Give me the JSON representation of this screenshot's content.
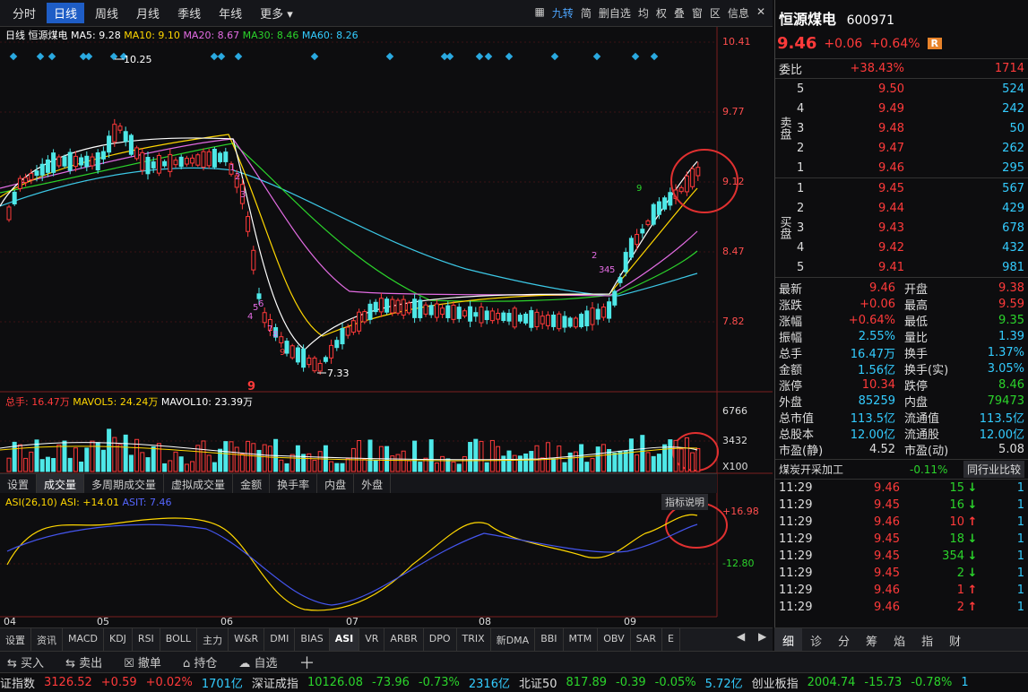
{
  "period_tabs": [
    "分时",
    "日线",
    "周线",
    "月线",
    "季线",
    "年线",
    "更多 ▾"
  ],
  "toolbar": {
    "items": [
      "▦",
      "九转",
      "简",
      "删自选",
      "均",
      "权",
      "叠",
      "窗",
      "区",
      "信息"
    ],
    "close": "✕"
  },
  "chart": {
    "legend": {
      "name": "日线",
      "stock": "恒源煤电",
      "ma5": "MA5: 9.28",
      "ma10": "MA10: 9.10",
      "ma20": "MA20: 8.67",
      "ma30": "MA30: 8.46",
      "ma60": "MA60: 8.26"
    },
    "price_ticks": [
      "10.41",
      "9.77",
      "9.12",
      "8.47",
      "7.82"
    ],
    "high_label": "10.25",
    "low_label": "7.33",
    "bottom_mark": "9",
    "td_left": [
      "1",
      "2",
      "3",
      "4",
      "5",
      "6",
      "7",
      "8",
      "9"
    ],
    "td_right": [
      "2",
      "3",
      "4",
      "5",
      "9"
    ],
    "vol_legend": {
      "total": "总手: 16.47万",
      "mavol5": "MAVOL5: 24.24万",
      "mavol10": "MAVOL10: 23.39万"
    },
    "vol_ticks": [
      "6766",
      "3432",
      "X100"
    ],
    "indicator_tabs": [
      "设置",
      "成交量",
      "多周期成交量",
      "虚拟成交量",
      "金额",
      "换手率",
      "内盘",
      "外盘"
    ],
    "asi_legend": {
      "a": "ASI(26,10) ASI: +14.01",
      "b": "ASIT: 7.46"
    },
    "asi_ticks": [
      "+16.98",
      "-12.80"
    ],
    "indicator_help": "指标说明",
    "months": [
      "04",
      "05",
      "06",
      "07",
      "08",
      "09"
    ]
  },
  "bottom_tabs": [
    "设置",
    "资讯",
    "MACD",
    "KDJ",
    "RSI",
    "BOLL",
    "主力",
    "W&R",
    "DMI",
    "BIAS",
    "ASI",
    "VR",
    "ARBR",
    "DPO",
    "TRIX",
    "新DMA",
    "BBI",
    "MTM",
    "OBV",
    "SAR",
    "E"
  ],
  "nav": {
    "prev": "◀",
    "next": "▶"
  },
  "actions": [
    "买入",
    "卖出",
    "撤单",
    "持仓",
    "自选",
    "＋"
  ],
  "quote": {
    "name": "恒源煤电",
    "code": "600971",
    "price": "9.46",
    "chg": "+0.06",
    "pct": "+0.64%",
    "badge": "R",
    "weibi_label": "委比",
    "weibi": "+38.43%",
    "weibi_vol": "1714",
    "sell_label": "卖盘",
    "buy_label": "买盘",
    "sell": [
      {
        "n": "5",
        "p": "9.50",
        "v": "524"
      },
      {
        "n": "4",
        "p": "9.49",
        "v": "242"
      },
      {
        "n": "3",
        "p": "9.48",
        "v": "50"
      },
      {
        "n": "2",
        "p": "9.47",
        "v": "262"
      },
      {
        "n": "1",
        "p": "9.46",
        "v": "295"
      }
    ],
    "buy": [
      {
        "n": "1",
        "p": "9.45",
        "v": "567"
      },
      {
        "n": "2",
        "p": "9.44",
        "v": "429"
      },
      {
        "n": "3",
        "p": "9.43",
        "v": "678"
      },
      {
        "n": "4",
        "p": "9.42",
        "v": "432"
      },
      {
        "n": "5",
        "p": "9.41",
        "v": "981"
      }
    ],
    "stats": [
      [
        "最新",
        "9.46",
        "开盘",
        "9.38"
      ],
      [
        "涨跌",
        "+0.06",
        "最高",
        "9.59"
      ],
      [
        "涨幅",
        "+0.64%",
        "最低",
        "9.35"
      ],
      [
        "振幅",
        "2.55%",
        "量比",
        "1.39"
      ],
      [
        "总手",
        "16.47万",
        "换手",
        "1.37%"
      ],
      [
        "金额",
        "1.56亿",
        "换手(实)",
        "3.05%"
      ],
      [
        "涨停",
        "10.34",
        "跌停",
        "8.46"
      ],
      [
        "外盘",
        "85259",
        "内盘",
        "79473"
      ],
      [
        "总市值",
        "113.5亿",
        "流通值",
        "113.5亿"
      ],
      [
        "总股本",
        "12.00亿",
        "流通股",
        "12.00亿"
      ],
      [
        "市盈(静)",
        "4.52",
        "市盈(动)",
        "5.08"
      ]
    ],
    "sector": "煤炭开采加工",
    "sector_pct": "-0.11%",
    "sector_btn": "同行业比较",
    "ticks": [
      {
        "t": "11:29",
        "p": "9.46",
        "v": "15",
        "d": "down",
        "n": "1"
      },
      {
        "t": "11:29",
        "p": "9.45",
        "v": "16",
        "d": "down",
        "n": "1"
      },
      {
        "t": "11:29",
        "p": "9.46",
        "v": "10",
        "d": "up",
        "n": "1"
      },
      {
        "t": "11:29",
        "p": "9.45",
        "v": "18",
        "d": "down",
        "n": "1"
      },
      {
        "t": "11:29",
        "p": "9.45",
        "v": "354",
        "d": "down",
        "n": "1"
      },
      {
        "t": "11:29",
        "p": "9.45",
        "v": "2",
        "d": "down",
        "n": "1"
      },
      {
        "t": "11:29",
        "p": "9.46",
        "v": "1",
        "d": "up",
        "n": "1"
      },
      {
        "t": "11:29",
        "p": "9.46",
        "v": "2",
        "d": "up",
        "n": "1"
      }
    ],
    "right_tabs": [
      "细",
      "诊",
      "分",
      "筹",
      "焰",
      "指",
      "财"
    ]
  },
  "ticker": [
    {
      "name": "证指数",
      "v": "3126.52",
      "c": "+0.59",
      "p": "+0.02%",
      "a": "1701亿"
    },
    {
      "name": "深证成指",
      "v": "10126.08",
      "c": "-73.96",
      "p": "-0.73%",
      "a": "2316亿"
    },
    {
      "name": "北证50",
      "v": "817.89",
      "c": "-0.39",
      "p": "-0.05%",
      "a": "5.72亿"
    },
    {
      "name": "创业板指",
      "v": "2004.74",
      "c": "-15.73",
      "p": "-0.78%",
      "a": "1"
    }
  ]
}
